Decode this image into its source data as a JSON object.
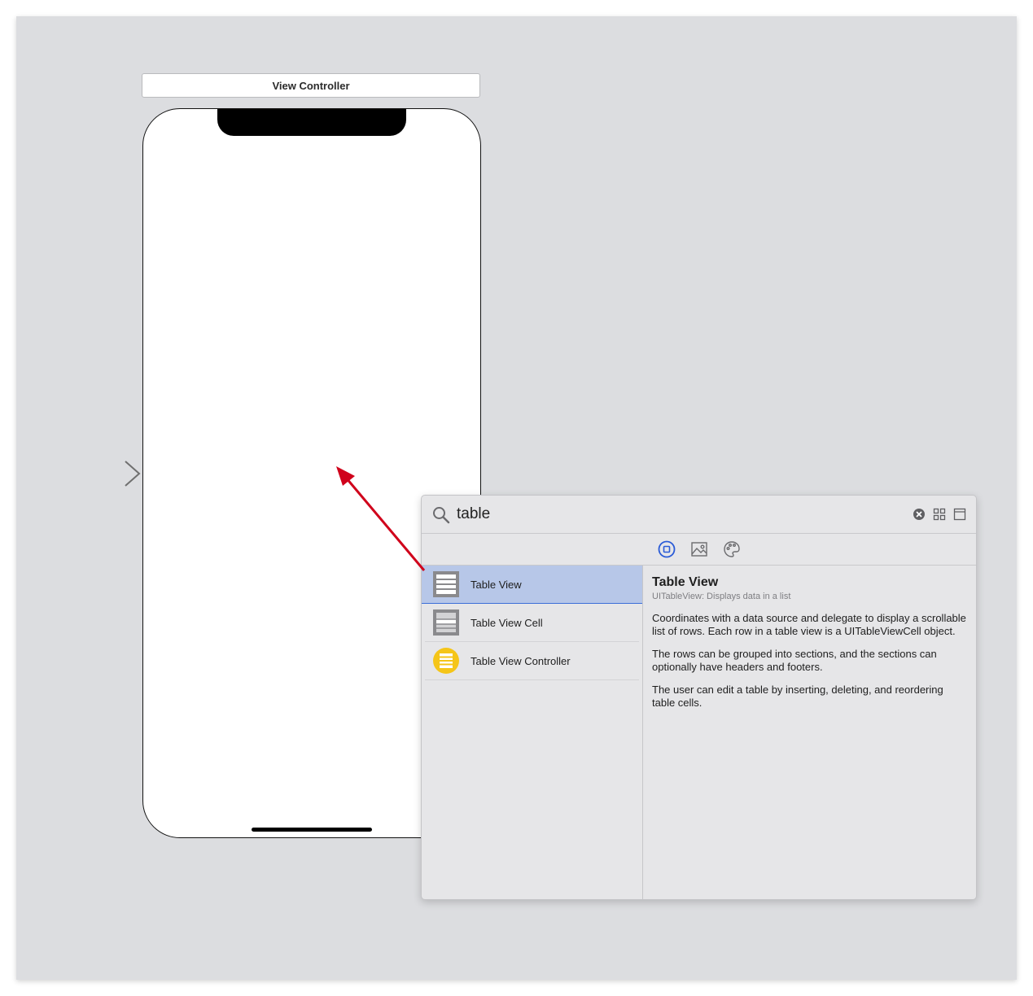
{
  "storyboard": {
    "scene_title": "View Controller"
  },
  "library": {
    "search": {
      "value": "table",
      "placeholder": "Filter"
    },
    "icons": {
      "search": "search-icon",
      "clear": "clear-icon",
      "grid_view": "grid-view-icon",
      "detail_view": "detail-view-icon",
      "objects_tab": "objects-icon",
      "media_tab": "image-icon",
      "colors_tab": "palette-icon"
    },
    "items": [
      {
        "label": "Table View",
        "selected": true,
        "icon": "table-view-icon"
      },
      {
        "label": "Table View Cell",
        "selected": false,
        "icon": "table-view-cell-icon"
      },
      {
        "label": "Table View Controller",
        "selected": false,
        "icon": "table-view-controller-icon"
      }
    ],
    "detail": {
      "title": "Table View",
      "subtitle": "UITableView: Displays data in a list",
      "paragraphs": [
        "Coordinates with a data source and delegate to display a scrollable list of rows. Each row in a table view is a UITableViewCell object.",
        "The rows can be grouped into sections, and the sections can optionally have headers and footers.",
        "The user can edit a table by inserting, deleting, and reordering table cells."
      ]
    }
  },
  "colors": {
    "selection": "#b7c7e8",
    "accent_blue": "#2a5bd7",
    "annotation_arrow": "#d0021b",
    "controller_icon": "#f5c518"
  }
}
